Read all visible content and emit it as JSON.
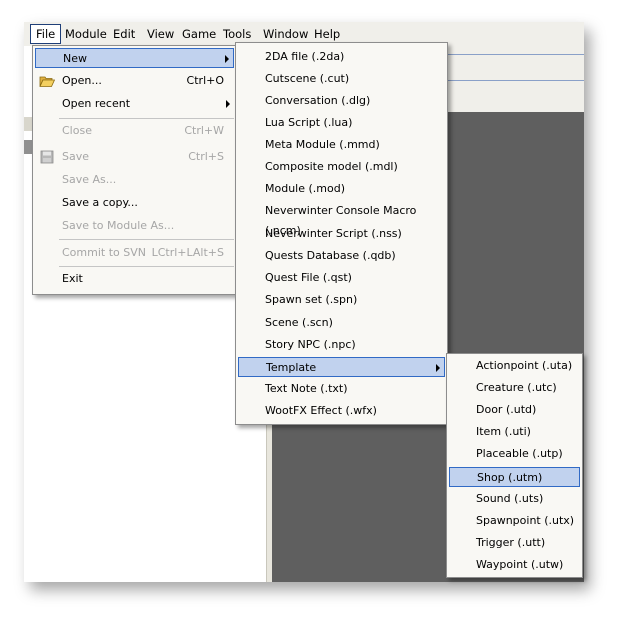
{
  "menubar": {
    "items": [
      "File",
      "Module",
      "Edit",
      "View",
      "Game",
      "Tools",
      "Window",
      "Help"
    ]
  },
  "file_menu": {
    "items": [
      {
        "label": "New",
        "shortcut": "",
        "disabled": false,
        "submenu": true,
        "highlighted": true
      },
      {
        "label": "Open...",
        "shortcut": "Ctrl+O",
        "disabled": false,
        "icon": "open-folder-icon"
      },
      {
        "label": "Open recent",
        "shortcut": "",
        "disabled": false,
        "submenu": true
      },
      {
        "label": "Close",
        "shortcut": "Ctrl+W",
        "disabled": true
      },
      {
        "label": "Save",
        "shortcut": "Ctrl+S",
        "disabled": true,
        "icon": "save-disk-icon"
      },
      {
        "label": "Save As...",
        "shortcut": "",
        "disabled": true
      },
      {
        "label": "Save a copy...",
        "shortcut": "",
        "disabled": false
      },
      {
        "label": "Save to Module As...",
        "shortcut": "",
        "disabled": true
      },
      {
        "label": "Commit to SVN",
        "shortcut": "LCtrl+LAlt+S",
        "disabled": true
      },
      {
        "label": "Exit",
        "shortcut": "",
        "disabled": false
      }
    ]
  },
  "new_menu": {
    "items": [
      "2DA file (.2da)",
      "Cutscene (.cut)",
      "Conversation (.dlg)",
      "Lua Script (.lua)",
      "Meta Module (.mmd)",
      "Composite model (.mdl)",
      "Module (.mod)",
      "Neverwinter Console Macro (.ncm)",
      "Neverwinter Script (.nss)",
      "Quests Database (.qdb)",
      "Quest File (.qst)",
      "Spawn set (.spn)",
      "Scene (.scn)",
      "Story NPC (.npc)",
      "Template",
      "Text Note (.txt)",
      "WootFX Effect (.wfx)"
    ],
    "highlighted": "Template"
  },
  "template_menu": {
    "items": [
      "Actionpoint (.uta)",
      "Creature (.utc)",
      "Door (.utd)",
      "Item (.uti)",
      "Placeable (.utp)",
      "Shop (.utm)",
      "Sound (.uts)",
      "Spawnpoint (.utx)",
      "Trigger (.utt)",
      "Waypoint (.utw)"
    ],
    "highlighted": "Shop (.utm)"
  },
  "colors": {
    "highlight_bg": "#c1d2ee",
    "highlight_border": "#316ac5",
    "disabled_text": "#a6a6a6",
    "dark_panel": "#5f5f5f"
  }
}
